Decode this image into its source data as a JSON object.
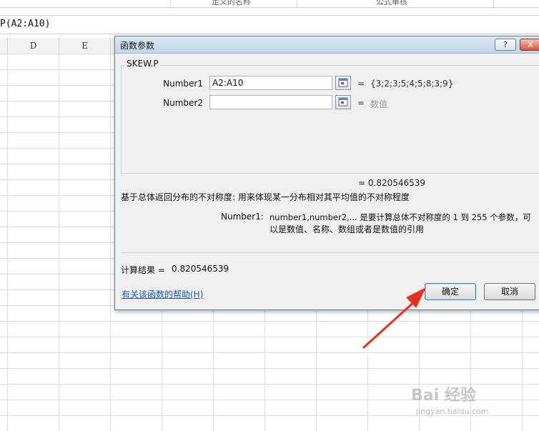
{
  "ribbon": {
    "group1": "定义的名称",
    "group2": "公式审核"
  },
  "formula_bar": {
    "text": "P(A2:A10)"
  },
  "columns": [
    "D",
    "E"
  ],
  "dialog": {
    "title": "函数参数",
    "help_button": "?",
    "close_button": "X",
    "function_name": "SKEW.P",
    "args": [
      {
        "label": "Number1",
        "value": "A2:A10",
        "equals": "=",
        "result": "{3;2;3;5;4;5;8;3;9}"
      },
      {
        "label": "Number2",
        "value": "",
        "equals": "=",
        "result": "数值"
      }
    ],
    "formula_result": "=  0.820546539",
    "description": "基于总体返回分布的不对称度: 用来体现某一分布相对其平均值的不对称程度",
    "arg_help_label": "Number1:",
    "arg_help_line1": "number1,number2,... 是要计算总体不对称度的 1 到 255 个参数，可",
    "arg_help_line2": "以是数值、名称、数组或者是数值的引用",
    "calc_result_label": "计算结果 =",
    "calc_result_value": "0.820546539",
    "help_link": "有关该函数的帮助(H)",
    "ok_button": "确定",
    "cancel_button": "取消"
  },
  "annotation": {
    "arrow_color": "#e8301f"
  },
  "watermark": {
    "text": "Bai 经验",
    "sub": "jingyan.baidu.com"
  }
}
